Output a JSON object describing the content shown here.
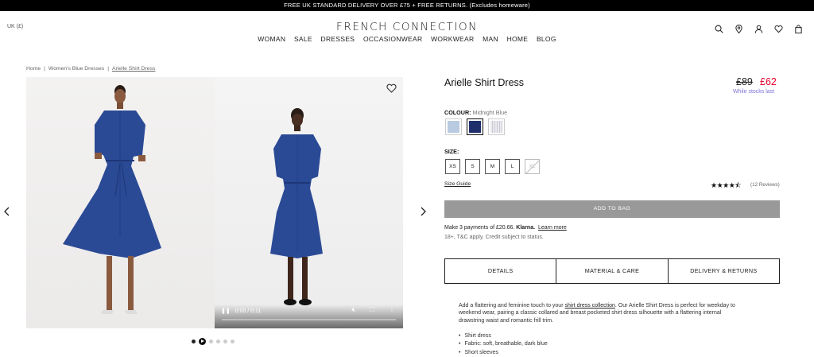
{
  "promo_bar": "FREE UK STANDARD DELIVERY OVER £75 + FREE RETURNS. (Excludes homeware)",
  "locale": "UK (£)",
  "brand": "FRENCH CONNECTION",
  "nav": [
    "WOMAN",
    "SALE",
    "DRESSES",
    "OCCASIONWEAR",
    "WORKWEAR",
    "MAN",
    "HOME",
    "BLOG"
  ],
  "header_icons": [
    "search-icon",
    "store-locator-icon",
    "account-icon",
    "wishlist-icon",
    "bag-icon"
  ],
  "breadcrumb": [
    "Home",
    "Women's Blue Dresses",
    "Arielle Shirt Dress"
  ],
  "video": {
    "time": "0:00 / 0:11",
    "progress": 0.0
  },
  "gallery": {
    "dots": 6,
    "active_index": 0,
    "video_index": 1
  },
  "product": {
    "title": "Arielle Shirt Dress",
    "price_old": "£89",
    "price_new": "£62",
    "stock_note": "While stocks last",
    "colour_label": "COLOUR:",
    "colour_value": "Midnight Blue",
    "swatches": [
      {
        "name": "light-blue",
        "color": "#b8cbe0",
        "selected": false
      },
      {
        "name": "midnight-blue",
        "color": "#1f2f6b",
        "selected": true
      },
      {
        "name": "grey-stripe",
        "color": "#dcdce4",
        "selected": false
      }
    ],
    "size_label": "SIZE:",
    "sizes": [
      {
        "label": "XS",
        "available": true
      },
      {
        "label": "S",
        "available": true
      },
      {
        "label": "M",
        "available": true
      },
      {
        "label": "L",
        "available": true
      },
      {
        "label": "XL",
        "available": false
      }
    ],
    "size_guide": "Size Guide",
    "rating": 4.5,
    "reviews": "(12 Reviews)",
    "add_to_bag": "ADD TO BAG",
    "klarna_prefix": "Make 3 payments of £20.66.",
    "klarna_brand": "Klarna.",
    "klarna_link": "Learn more",
    "klarna_note": "18+, T&C apply. Credit subject to status."
  },
  "tabs": [
    "DETAILS",
    "MATERIAL & CARE",
    "DELIVERY & RETURNS"
  ],
  "details": {
    "desc_before": "Add a flattering and feminine touch to your ",
    "desc_link": "shirt dress collection",
    "desc_after": ". Our Arielle Shirt Dress is perfect for weekday to weekend wear, pairing a classic collared and breast pocketed shirt dress silhouette with a flattering internal drawstring waist and romantic frill trim.",
    "bullets": [
      "Shirt dress",
      "Fabric: soft, breathable, dark blue",
      "Short sleeves"
    ]
  },
  "colors": {
    "dress": "#2b4a95",
    "sale_red": "#e4002b",
    "klarna_link": "#7b73d6",
    "bag_button": "#999999"
  }
}
